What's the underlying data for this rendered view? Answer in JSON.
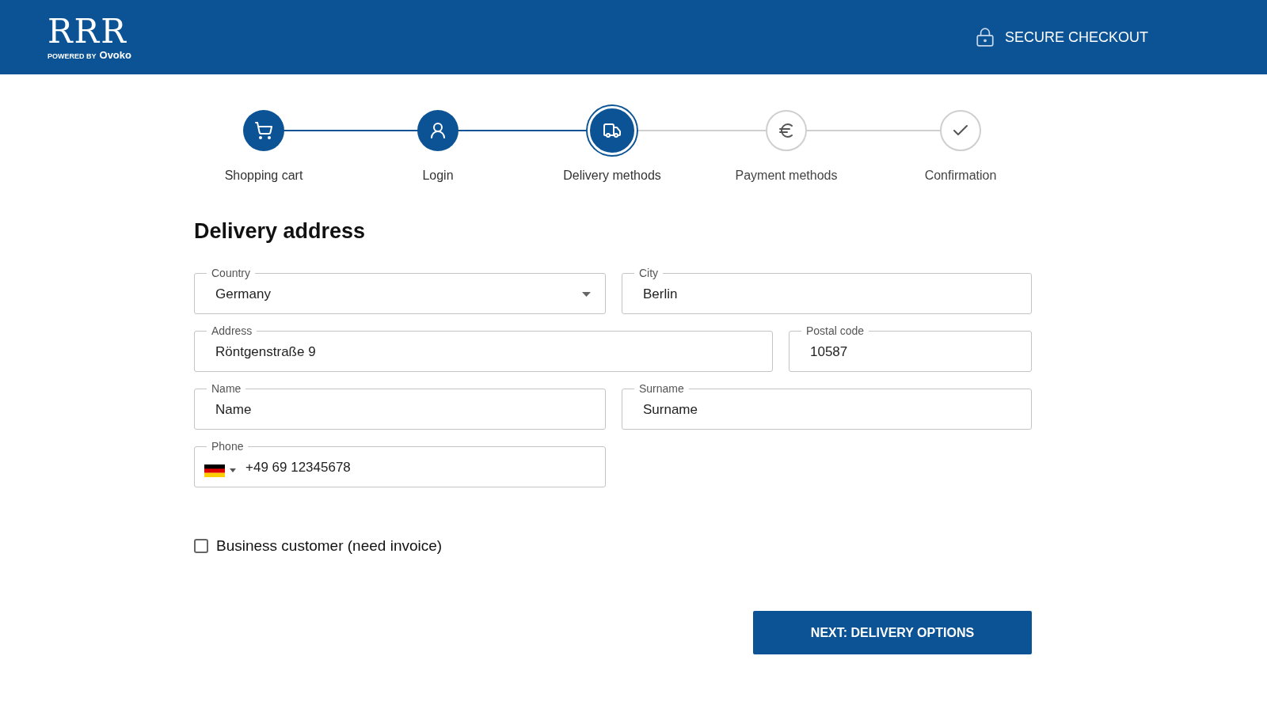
{
  "header": {
    "logo": {
      "mark": "RRR",
      "powered_by": "POWERED BY",
      "brand": "Ovoko"
    },
    "secure": "SECURE CHECKOUT"
  },
  "steps": [
    {
      "label": "Shopping cart",
      "kind": "cart",
      "completed": true,
      "selected": false
    },
    {
      "label": "Login",
      "kind": "user",
      "completed": true,
      "selected": false
    },
    {
      "label": "Delivery methods",
      "kind": "truck",
      "completed": false,
      "selected": true
    },
    {
      "label": "Payment methods",
      "kind": "euro",
      "completed": false,
      "selected": false
    },
    {
      "label": "Confirmation",
      "kind": "check",
      "completed": false,
      "selected": false
    }
  ],
  "title": "Delivery address",
  "fields": [
    {
      "label": "Country",
      "kind": "select",
      "value": "Germany"
    },
    {
      "label": "City",
      "kind": "text",
      "value": "Berlin"
    },
    {
      "label": "Address",
      "kind": "text",
      "value": "Röntgenstraße 9"
    },
    {
      "label": "Postal code",
      "kind": "text",
      "value": "10587"
    },
    {
      "label": "Name",
      "kind": "text",
      "placeholder": "Name"
    },
    {
      "label": "Surname",
      "kind": "text",
      "placeholder": "Surname"
    },
    {
      "label": "Phone",
      "kind": "phone",
      "value": "+49 69 12345678"
    }
  ],
  "business": {
    "label": "Business customer (need invoice)",
    "checked": false
  },
  "next_button": "NEXT: DELIVERY OPTIONS"
}
